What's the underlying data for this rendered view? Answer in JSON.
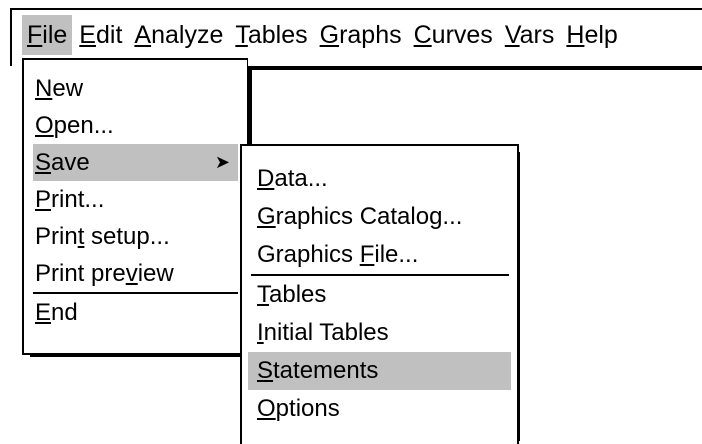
{
  "menubar": {
    "items": [
      {
        "mnemonic": "F",
        "rest": "ile"
      },
      {
        "mnemonic": "E",
        "rest": "dit"
      },
      {
        "mnemonic": "A",
        "rest": "nalyze"
      },
      {
        "mnemonic": "T",
        "rest": "ables"
      },
      {
        "mnemonic": "G",
        "rest": "raphs"
      },
      {
        "mnemonic": "C",
        "rest": "urves"
      },
      {
        "mnemonic": "V",
        "rest": "ars"
      },
      {
        "mnemonic": "H",
        "rest": "elp"
      }
    ]
  },
  "file_menu": {
    "new": {
      "pre": "",
      "mnemonic": "N",
      "post": "ew"
    },
    "open": {
      "pre": "",
      "mnemonic": "O",
      "post": "pen..."
    },
    "save": {
      "pre": "",
      "mnemonic": "S",
      "post": "ave"
    },
    "print": {
      "pre": "",
      "mnemonic": "P",
      "post": "rint..."
    },
    "print_setup": {
      "pre": "Prin",
      "mnemonic": "t",
      "post": " setup..."
    },
    "print_preview": {
      "pre": "Print pre",
      "mnemonic": "v",
      "post": "iew"
    },
    "end": {
      "pre": "",
      "mnemonic": "E",
      "post": "nd"
    },
    "submenu_arrow": "➤"
  },
  "save_submenu": {
    "data": {
      "pre": "",
      "mnemonic": "D",
      "post": "ata..."
    },
    "graphics_catalog": {
      "pre": "",
      "mnemonic": "G",
      "post": "raphics Catalog..."
    },
    "graphics_file": {
      "pre": "Graphics ",
      "mnemonic": "F",
      "post": "ile..."
    },
    "tables": {
      "pre": "",
      "mnemonic": "T",
      "post": "ables"
    },
    "initial_tables": {
      "pre": "",
      "mnemonic": "I",
      "post": "nitial Tables"
    },
    "statements": {
      "pre": "",
      "mnemonic": "S",
      "post": "tatements"
    },
    "options": {
      "pre": "",
      "mnemonic": "O",
      "post": "ptions"
    }
  },
  "colors": {
    "highlight": "#c0c0c0",
    "border": "#000000",
    "background": "#ffffff"
  }
}
